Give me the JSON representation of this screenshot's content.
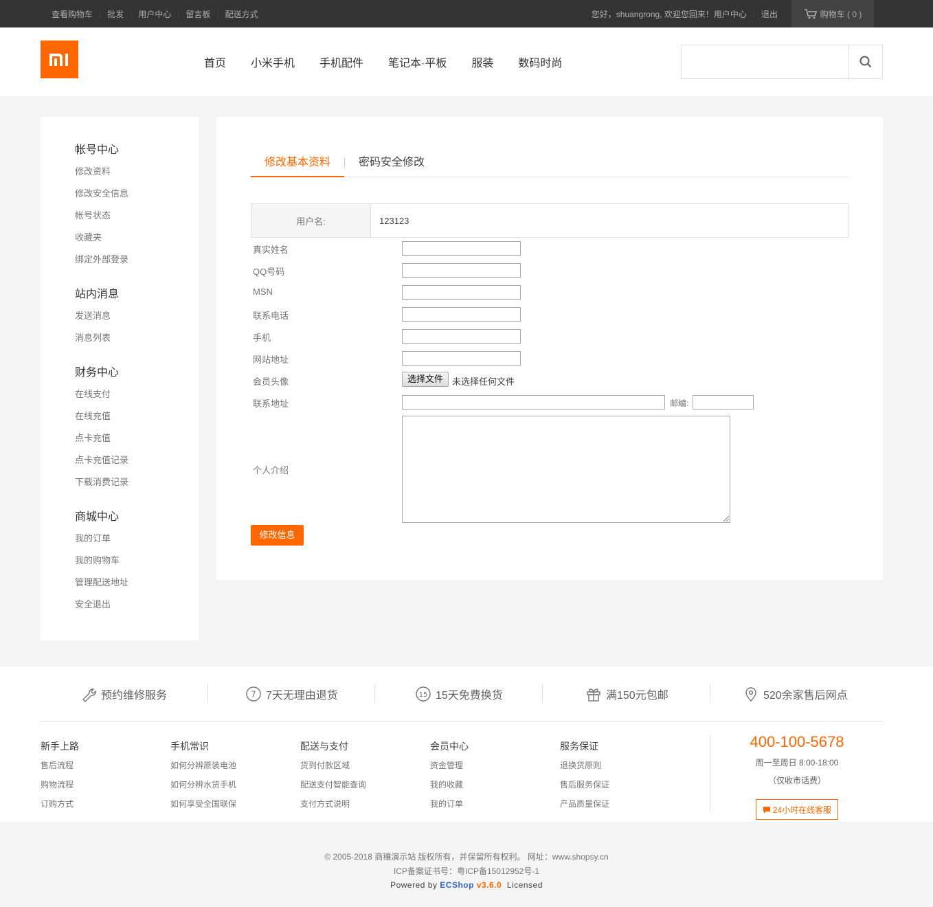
{
  "topbar": {
    "links": [
      "查看购物车",
      "批发",
      "用户中心",
      "留言板",
      "配送方式"
    ],
    "separator": "|",
    "welcome": "您好，shuangrong, 欢迎您回来！用户中心",
    "logout": "退出",
    "cart": "购物车 ( 0 )"
  },
  "header": {
    "logo_text": "mi",
    "nav": [
      "首页",
      "小米手机",
      "手机配件",
      "笔记本·平板",
      "服装",
      "数码时尚"
    ],
    "search_placeholder": ""
  },
  "sidebar": {
    "groups": [
      {
        "title": "帐号中心",
        "items": [
          "修改资料",
          "修改安全信息",
          "帐号状态",
          "收藏夹",
          "绑定外部登录"
        ]
      },
      {
        "title": "站内消息",
        "items": [
          "发送消息",
          "消息列表"
        ]
      },
      {
        "title": "财务中心",
        "items": [
          "在线支付",
          "在线充值",
          "点卡充值",
          "点卡充值记录",
          "下载消费记录"
        ]
      },
      {
        "title": "商城中心",
        "items": [
          "我的订单",
          "我的购物车",
          "管理配送地址",
          "安全退出"
        ]
      }
    ]
  },
  "main": {
    "tabs": [
      "修改基本资料",
      "密码安全修改"
    ],
    "username_label": "用户名:",
    "username_value": "123123",
    "fields": [
      "真实姓名",
      "QQ号码",
      "MSN",
      "联系电话",
      "手机",
      "网站地址"
    ],
    "avatar_label": "会员头像",
    "file_button": "选择文件",
    "file_status": "未选择任何文件",
    "address_label": "联系地址",
    "zip_label": "邮编:",
    "intro_label": "个人介绍",
    "submit": "修改信息"
  },
  "footer": {
    "services": [
      "预约维修服务",
      "7天无理由退货",
      "15天免费换货",
      "满150元包邮",
      "520余家售后网点"
    ],
    "columns": [
      {
        "title": "新手上路",
        "items": [
          "售后流程",
          "购物流程",
          "订购方式"
        ]
      },
      {
        "title": "手机常识",
        "items": [
          "如何分辨原装电池",
          "如何分辨水货手机",
          "如何享受全国联保"
        ]
      },
      {
        "title": "配送与支付",
        "items": [
          "货到付款区域",
          "配送支付智能查询",
          "支付方式说明"
        ]
      },
      {
        "title": "会员中心",
        "items": [
          "资金管理",
          "我的收藏",
          "我的订单"
        ]
      },
      {
        "title": "服务保证",
        "items": [
          "退换货原则",
          "售后服务保证",
          "产品质量保证"
        ]
      }
    ],
    "phone": "400-100-5678",
    "hours": "周一至周日 8:00-18:00",
    "note": "（仅收市话费）",
    "online": "24小时在线客服"
  },
  "copyright": {
    "line1": "© 2005-2018 商穰演示站 版权所有，并保留所有权利。 网址：www.shopsy.cn",
    "line2": "ICP备案证书号：粤ICP备15012952号-1",
    "powered": "Powered by",
    "brand": "ECShop",
    "version": "v3.6.0",
    "licensed": "Licensed"
  },
  "colors": {
    "accent": "#ff6700",
    "topbar": "#333333"
  }
}
